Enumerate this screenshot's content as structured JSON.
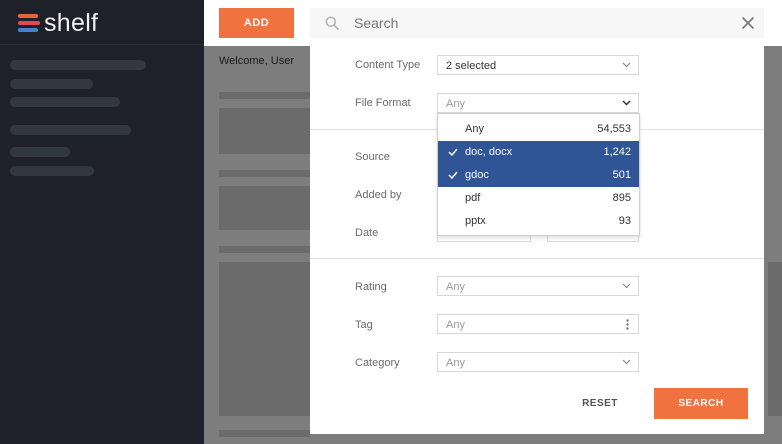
{
  "app": {
    "logo_text": "shelf"
  },
  "topbar": {
    "add_label": "ADD",
    "welcome": "Welcome, User"
  },
  "search": {
    "placeholder": "Search"
  },
  "filters": {
    "content_type": {
      "label": "Content Type",
      "value": "2 selected"
    },
    "file_format": {
      "label": "File Format",
      "value": "Any"
    },
    "source": {
      "label": "Source"
    },
    "added_by": {
      "label": "Added by"
    },
    "date": {
      "label": "Date"
    },
    "rating": {
      "label": "Rating",
      "value": "Any"
    },
    "tag": {
      "label": "Tag",
      "value": "Any"
    },
    "category": {
      "label": "Category",
      "value": "Any"
    }
  },
  "dropdown": {
    "options": [
      {
        "name": "Any",
        "count": "54,553",
        "selected": false
      },
      {
        "name": "doc, docx",
        "count": "1,242",
        "selected": true
      },
      {
        "name": "gdoc",
        "count": "501",
        "selected": true
      },
      {
        "name": "pdf",
        "count": "895",
        "selected": false
      },
      {
        "name": "pptx",
        "count": "93",
        "selected": false
      }
    ]
  },
  "actions": {
    "reset_label": "RESET",
    "search_label": "SEARCH"
  },
  "colors": {
    "accent": "#f0723f",
    "selected": "#2f5597",
    "sidebar": "#1e2129"
  },
  "icons": {
    "search": "search-icon",
    "close": "close-icon",
    "chevron": "chevron-down-icon",
    "check": "check-icon",
    "more": "more-vertical-icon"
  }
}
